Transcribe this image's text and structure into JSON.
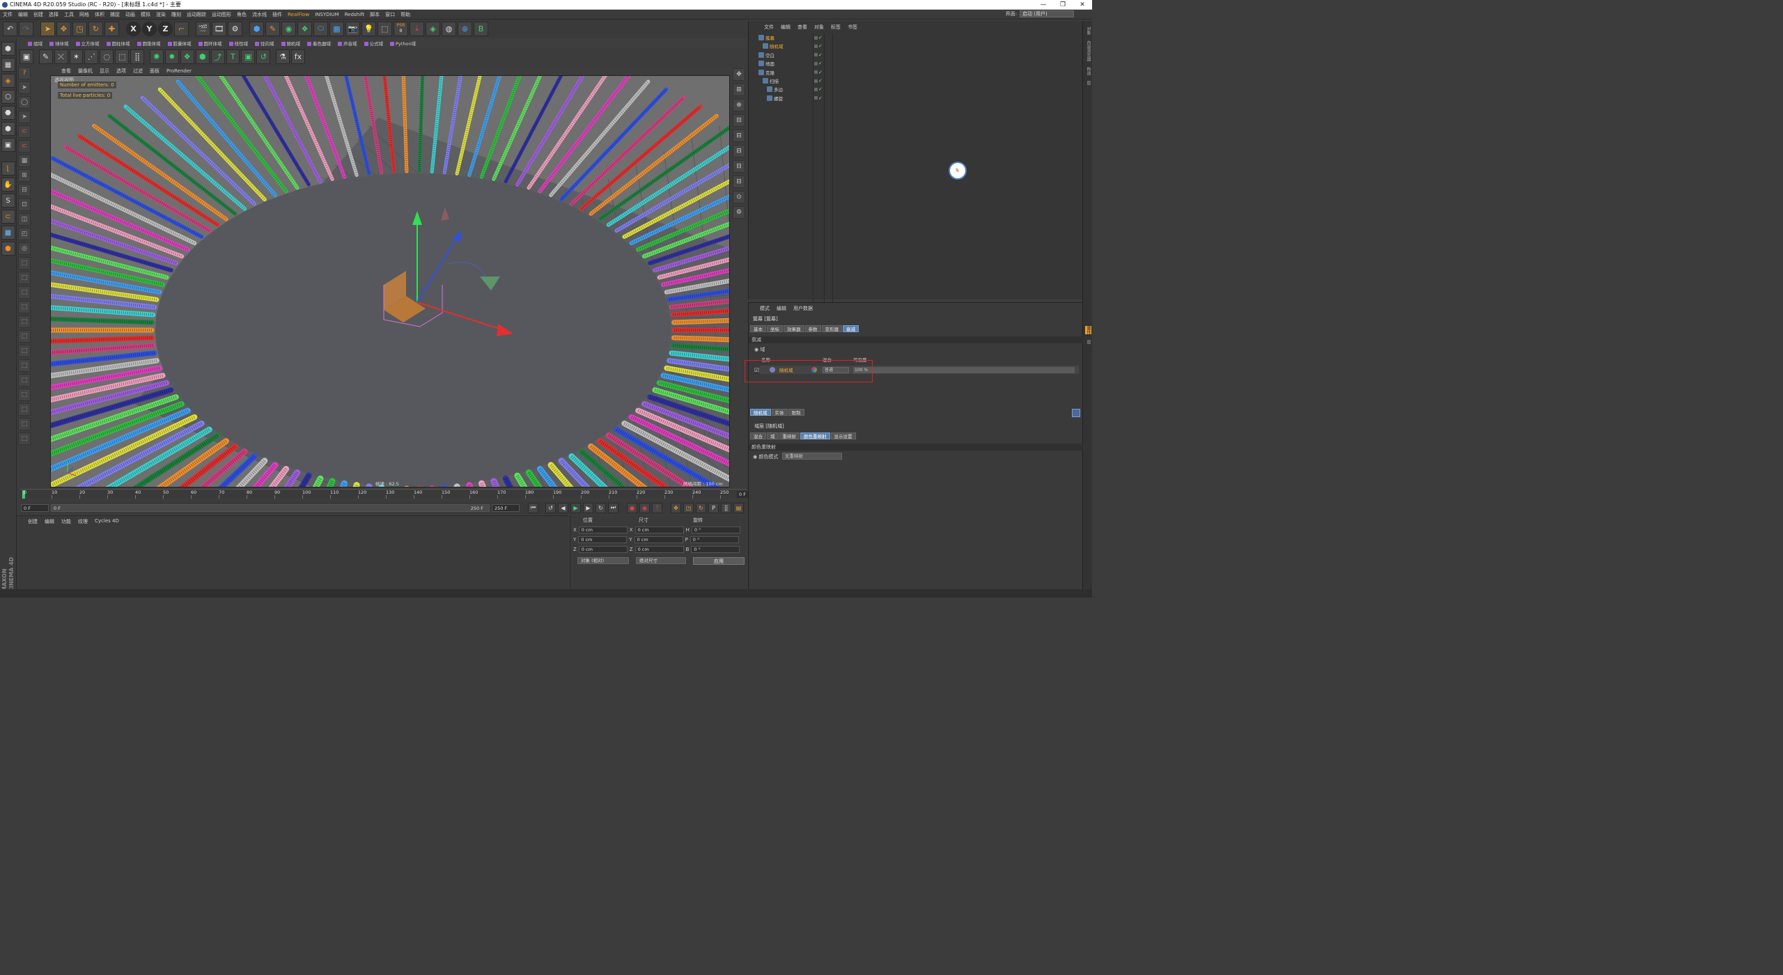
{
  "window": {
    "title": "CINEMA 4D R20.059 Studio (RC - R20) - [未标题 1.c4d *] - 主要",
    "controls": [
      "—",
      "❐",
      "✕"
    ]
  },
  "menubar": {
    "items": [
      "文件",
      "编辑",
      "创建",
      "选择",
      "工具",
      "网格",
      "体积",
      "捕捉",
      "动画",
      "模拟",
      "渲染",
      "雕刻",
      "运动跟踪",
      "运动图形",
      "角色",
      "流水线",
      "插件",
      "RealFlow",
      "INSYDIUM",
      "Redshift",
      "脚本",
      "窗口",
      "帮助"
    ],
    "layout_label": "界面:",
    "layout_value": "启动 (用户)"
  },
  "toolbar1": {
    "axis": [
      "X",
      "Y",
      "Z"
    ],
    "psr": "PSR",
    "psr_value": "0"
  },
  "toolbar2": {
    "items": [
      "组域",
      "球体域",
      "立方体域",
      "圆柱体域",
      "圆锥体域",
      "胶囊体域",
      "圆环体域",
      "线性域",
      "径向域",
      "随机域",
      "着色器域",
      "声音域",
      "公式域",
      "Python域"
    ]
  },
  "viewport": {
    "menu": [
      "查看",
      "摄像机",
      "显示",
      "选项",
      "过滤",
      "面板",
      "ProRender"
    ],
    "label": "透视视图",
    "emitters": "Number of emitters: 0",
    "particles": "Total live particles: 0",
    "speed": "帧速 : 62.5",
    "grid": "网格间距 : 100 cm"
  },
  "timeline": {
    "ticks": [
      "0",
      "10",
      "20",
      "30",
      "40",
      "50",
      "60",
      "70",
      "80",
      "90",
      "100",
      "110",
      "120",
      "130",
      "140",
      "150",
      "160",
      "170",
      "180",
      "190",
      "200",
      "210",
      "220",
      "230",
      "240",
      "250"
    ],
    "end": "0 F"
  },
  "transport": {
    "start": "0 F",
    "cur": "0 F",
    "end1": "250 F",
    "end2": "250 F"
  },
  "material": {
    "menu": [
      "创建",
      "编辑",
      "功能",
      "纹理",
      "Cycles 4D"
    ],
    "maxon": "MAXON CINEMA 4D"
  },
  "coords": {
    "h_pos": "位置",
    "h_size": "尺寸",
    "h_rot": "旋转",
    "rows": [
      {
        "a": "X",
        "p": "0 cm",
        "b": "X",
        "s": "0 cm",
        "c": "H",
        "r": "0 °"
      },
      {
        "a": "Y",
        "p": "0 cm",
        "b": "Y",
        "s": "0 cm",
        "c": "P",
        "r": "0 °"
      },
      {
        "a": "Z",
        "p": "0 cm",
        "b": "Z",
        "s": "0 cm",
        "c": "B",
        "r": "0 °"
      }
    ],
    "mode": "对象 (相对)",
    "size_mode": "绝对尺寸",
    "apply": "应用"
  },
  "objects": {
    "menu": [
      "文件",
      "编辑",
      "查看",
      "对象",
      "标签",
      "书签"
    ],
    "rows": [
      {
        "name": "簇幕",
        "sel": true,
        "indent": 0
      },
      {
        "name": "随机域",
        "sel": true,
        "indent": 1
      },
      {
        "name": "空白",
        "sel": false,
        "indent": 0
      },
      {
        "name": "地面",
        "sel": false,
        "indent": 0
      },
      {
        "name": "克隆",
        "sel": false,
        "indent": 0
      },
      {
        "name": "扫描",
        "sel": false,
        "indent": 1
      },
      {
        "name": "多边",
        "sel": false,
        "indent": 2
      },
      {
        "name": "螺旋",
        "sel": false,
        "indent": 2
      }
    ]
  },
  "attrs": {
    "menu": [
      "模式",
      "编辑",
      "用户数据"
    ],
    "title": "簇幕 [簇幕]",
    "tabs": [
      "基本",
      "坐标",
      "效果器",
      "参数",
      "变形器",
      "衰减"
    ],
    "active_tab": "衰减",
    "section": "衰减",
    "field_label": "域",
    "col_name": "名称",
    "col_mix": "混合",
    "col_vis": "可见度",
    "row_name": "随机域",
    "row_mix": "普通",
    "row_vis": "100 %",
    "sub_tabs": [
      "随机域",
      "实体",
      "限制"
    ],
    "layer_title": "域层 [随机域]",
    "layer_tabs": [
      "混合",
      "域",
      "重映射",
      "颜色重映射",
      "显示设置"
    ],
    "layer_active": "颜色重映射",
    "color_section": "颜色重映射",
    "color_mode_label": "颜色模式",
    "color_mode_value": "无重映射"
  },
  "side_tabs": [
    "对象",
    "内容浏览器",
    "构造",
    "层"
  ],
  "side_tabs2": [
    "属性",
    "层"
  ],
  "colors": {
    "accent": "#f0a030",
    "selection": "#5a80b0",
    "highlight_box": "#e02020"
  }
}
